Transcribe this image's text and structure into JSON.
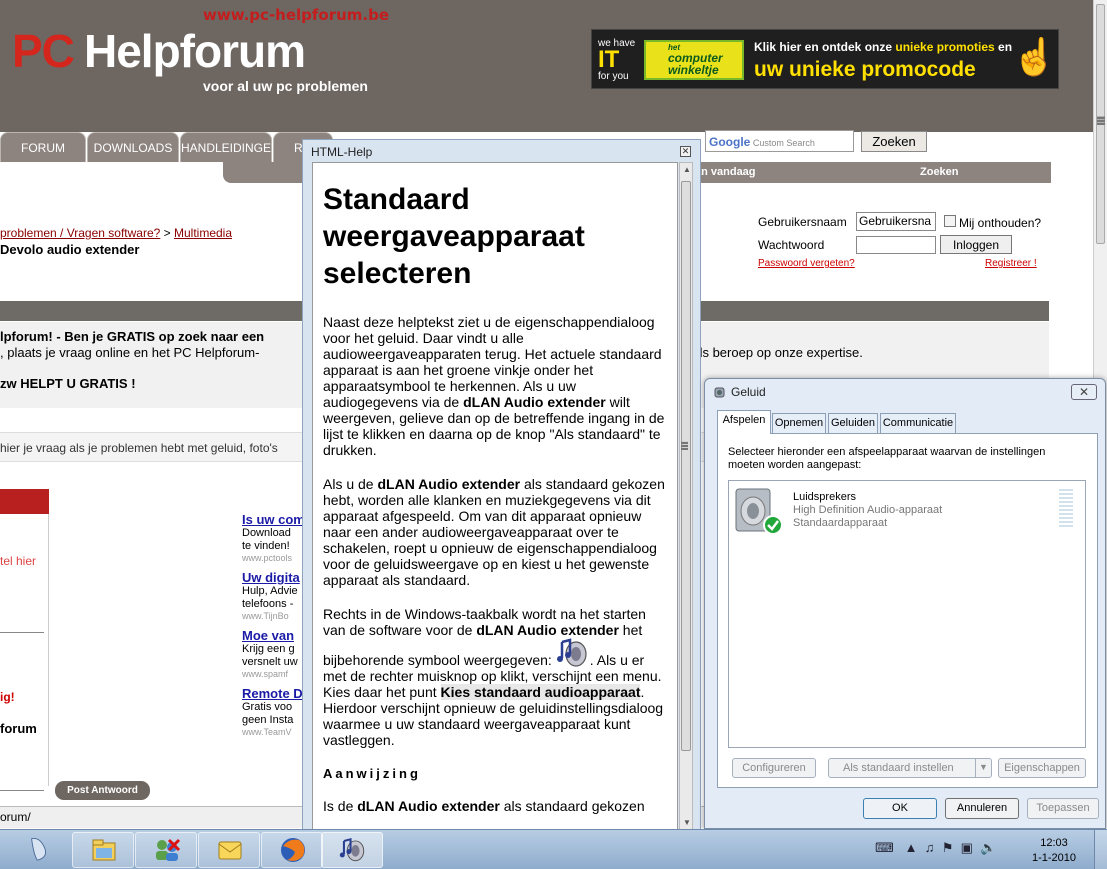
{
  "forum": {
    "site_url": "www.pc-helpforum.be",
    "logo_pc": "PC",
    "logo_help": "Helpforum",
    "tagline": "voor al uw pc problemen",
    "banner": {
      "it_top": "we have",
      "it_big": "IT",
      "it_bottom": "for you",
      "brand_small": "het",
      "brand": "computer winkeltje",
      "line1_a": "Klik hier en ontdek onze ",
      "line1_b": "unieke promoties",
      "line1_c": " en",
      "line2": "uw unieke promocode"
    },
    "tabs": [
      "FORUM",
      "DOWNLOADS",
      "HANDLEIDINGEN",
      "R"
    ],
    "search_placeholder": "Custom Search",
    "search_brand": "Google",
    "search_button": "Zoeken",
    "subnav_vandaag": "an vandaag",
    "subnav_zoeken": "Zoeken",
    "breadcrumb_link1": "problemen / Vragen software?",
    "breadcrumb_sep": " > ",
    "breadcrumb_link2": "Multimedia",
    "thread_title": "Devolo audio extender",
    "login": {
      "user_label": "Gebruikersnaam",
      "user_value": "Gebruikersna",
      "remember": "Mij onthouden?",
      "pass_label": "Wachtwoord",
      "login_button": "Inloggen",
      "forgot": "Passwoord vergeten?",
      "register": "Registreer !"
    },
    "welcome_1": "lpforum! - Ben je GRATIS op zoek naar een",
    "welcome_2": ", plaats je vraag online en het PC Helpforum-",
    "welcome_right": "eds beroep op onze expertise.",
    "helpt": "zw HELPT U GRATIS !",
    "hier_text": "hier je vraag als je problemen hebt met geluid, foto's",
    "stel_hier": "tel hier",
    "ig": "ig!",
    "forum_label": "forum",
    "ads": [
      {
        "title": "Is uw com",
        "desc1": "Download",
        "desc2": "te vinden!",
        "url": "www.pctools"
      },
      {
        "title": "Uw digita",
        "desc1": "Hulp, Advie",
        "desc2": "telefoons -",
        "url": "www.TijnBo"
      },
      {
        "title": "Moe van",
        "desc1": "Krijg een g",
        "desc2": "versnelt uw",
        "url": "www.spamf"
      },
      {
        "title": "Remote D",
        "desc1": "Gratis voo",
        "desc2": "geen Insta",
        "url": "www.TeamV"
      }
    ],
    "post_button": "Post Antwoord",
    "status_url": "orum/"
  },
  "help": {
    "window_title": "HTML-Help",
    "heading": "Standaard weergaveapparaat selecteren",
    "p1_a": "Naast deze helptekst ziet u de eigenschappendialoog voor het geluid. Daar vindt u alle audioweergaveapparaten terug. Het actuele standaard apparaat is aan het groene vinkje onder het apparaatsymbool te herkennen. Als u uw audiogegevens via de ",
    "p1_b": "dLAN Audio extender",
    "p1_c": " wilt weergeven, gelieve dan op de betreffende ingang in de lijst te klikken en daarna op de knop \"Als standaard\" te drukken.",
    "p2_a": "Als u de ",
    "p2_b": "dLAN Audio extender",
    "p2_c": " als standaard gekozen hebt, worden alle klanken en muziekgegevens via dit apparaat afgespeeld. Om van dit apparaat opnieuw naar een ander audioweergaveapparaat over te schakelen, roept u opnieuw de eigenschappendialoog voor de geluidsweergave op en kiest u het gewenste apparaat als standaard.",
    "p3_a": "Rechts in de Windows-taakbalk wordt na het starten van de software voor de ",
    "p3_b": "dLAN Audio extender",
    "p3_c": " het bijbehorende symbool weergegeven: ",
    "p3_d": ". Als u er met de rechter muisknop op klikt, verschijnt een menu. Kies daar het punt ",
    "p3_e": "Kies standaard audioapparaat",
    "p3_f": ". Hierdoor verschijnt opnieuw de geluidinstellingsdialoog waarmee u uw standaard weergaveapparaat kunt vastleggen.",
    "note_heading": "Aanwijzing",
    "note_a": "Is de ",
    "note_b": "dLAN Audio extender",
    "note_c": " als standaard gekozen"
  },
  "geluid": {
    "title": "Geluid",
    "close": "✕",
    "tabs": [
      "Afspelen",
      "Opnemen",
      "Geluiden",
      "Communicatie"
    ],
    "description": "Selecteer hieronder een afspeelapparaat waarvan de instellingen moeten worden aangepast:",
    "device": {
      "name": "Luidsprekers",
      "driver": "High Definition Audio-apparaat",
      "status": "Standaardapparaat"
    },
    "btn_configure": "Configureren",
    "btn_default": "Als standaard instellen",
    "btn_properties": "Eigenschappen",
    "btn_ok": "OK",
    "btn_cancel": "Annuleren",
    "btn_apply": "Toepassen"
  },
  "taskbar": {
    "time": "12:03",
    "date": "1-1-2010"
  },
  "colors": {
    "forum_header": "#6e6661",
    "accent_red": "#d4261d",
    "taskbar": "#9cb6d4"
  }
}
